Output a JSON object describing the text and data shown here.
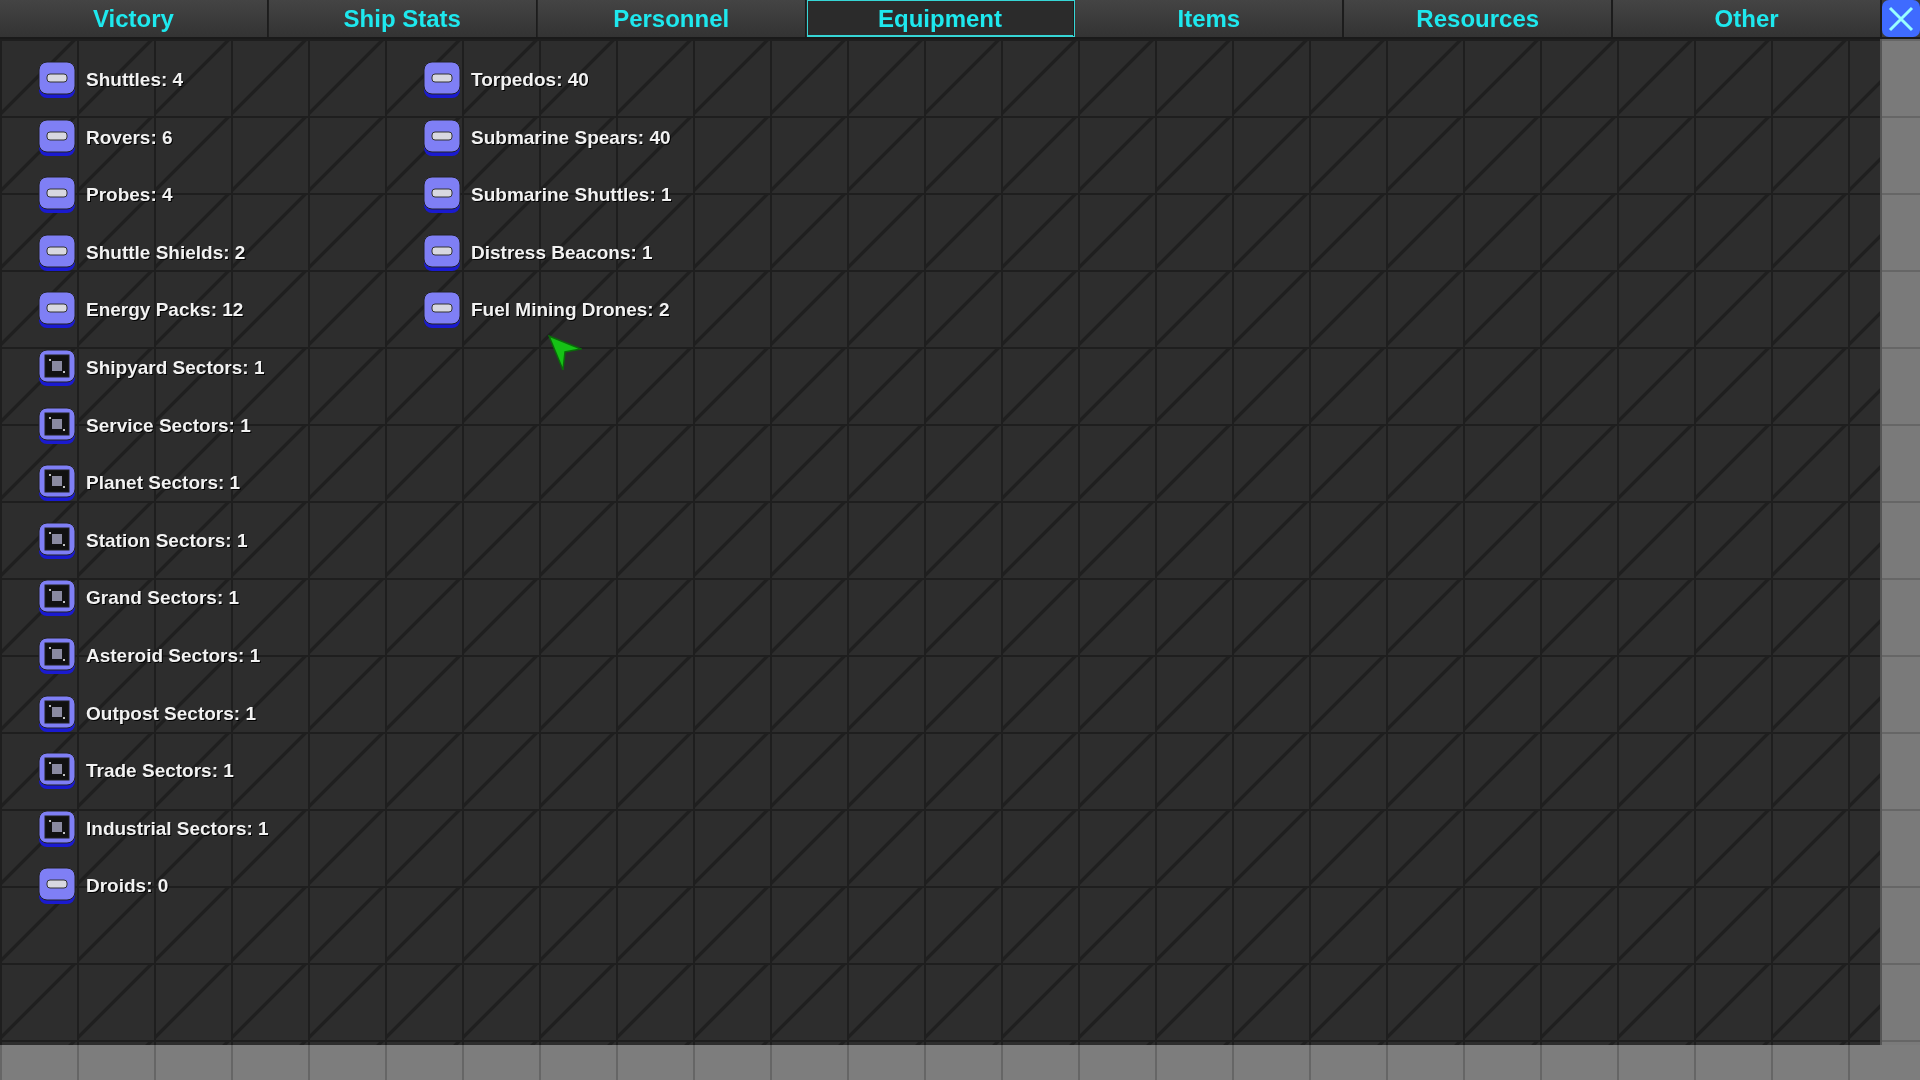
{
  "tabs": [
    {
      "label": "Victory",
      "selected": false
    },
    {
      "label": "Ship Stats",
      "selected": false
    },
    {
      "label": "Personnel",
      "selected": false
    },
    {
      "label": "Equipment",
      "selected": true
    },
    {
      "label": "Items",
      "selected": false
    },
    {
      "label": "Resources",
      "selected": false
    },
    {
      "label": "Other",
      "selected": false
    }
  ],
  "columns": [
    [
      {
        "label": "Shuttles: 4",
        "kind": "equipment"
      },
      {
        "label": "Rovers: 6",
        "kind": "equipment"
      },
      {
        "label": "Probes: 4",
        "kind": "equipment"
      },
      {
        "label": "Shuttle Shields: 2",
        "kind": "equipment"
      },
      {
        "label": "Energy Packs: 12",
        "kind": "equipment"
      },
      {
        "label": "Shipyard Sectors: 1",
        "kind": "sector"
      },
      {
        "label": "Service Sectors: 1",
        "kind": "sector"
      },
      {
        "label": "Planet Sectors: 1",
        "kind": "sector"
      },
      {
        "label": "Station Sectors: 1",
        "kind": "sector"
      },
      {
        "label": "Grand Sectors: 1",
        "kind": "sector"
      },
      {
        "label": "Asteroid Sectors: 1",
        "kind": "sector"
      },
      {
        "label": "Outpost Sectors: 1",
        "kind": "sector"
      },
      {
        "label": "Trade Sectors: 1",
        "kind": "sector"
      },
      {
        "label": "Industrial Sectors: 1",
        "kind": "sector"
      },
      {
        "label": "Droids: 0",
        "kind": "equipment"
      }
    ],
    [
      {
        "label": "Torpedos: 40",
        "kind": "equipment"
      },
      {
        "label": "Submarine Spears: 40",
        "kind": "equipment"
      },
      {
        "label": "Submarine Shuttles: 1",
        "kind": "equipment"
      },
      {
        "label": "Distress Beacons: 1",
        "kind": "equipment"
      },
      {
        "label": "Fuel Mining Drones: 2",
        "kind": "equipment"
      }
    ]
  ]
}
